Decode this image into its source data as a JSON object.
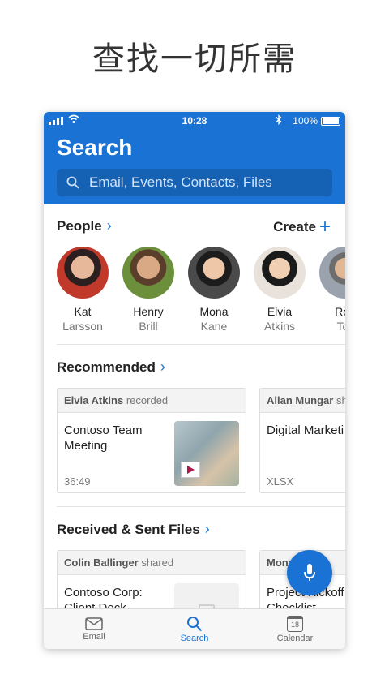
{
  "headline": "查找一切所需",
  "status": {
    "time": "10:28",
    "battery": "100%"
  },
  "header": {
    "title": "Search",
    "search_placeholder": "Email, Events, Contacts, Files"
  },
  "people": {
    "heading": "People",
    "create_label": "Create",
    "contacts": [
      {
        "first": "Kat",
        "last": "Larsson",
        "color": "#c0392b"
      },
      {
        "first": "Henry",
        "last": "Brill",
        "color": "#6b8f3a"
      },
      {
        "first": "Mona",
        "last": "Kane",
        "color": "#4a4a4a"
      },
      {
        "first": "Elvia",
        "last": "Atkins",
        "color": "#8e6b4e"
      },
      {
        "first": "Rob",
        "last": "Toll",
        "color": "#9aa3ad"
      }
    ]
  },
  "recommended": {
    "heading": "Recommended",
    "cards": [
      {
        "actor": "Elvia Atkins",
        "action": "recorded",
        "title": "Contoso Team Meeting",
        "meta": "36:49"
      },
      {
        "actor": "Allan Mungar",
        "action": "sh",
        "title": "Digital Marketi Plan",
        "meta": "XLSX"
      }
    ]
  },
  "files": {
    "heading": "Received & Sent Files",
    "cards": [
      {
        "actor": "Colin Ballinger",
        "action": "shared",
        "title": "Contoso Corp: Client Deck",
        "meta": ""
      },
      {
        "actor": "Mona",
        "action": "ma",
        "title": "Project Kickoff Checklist",
        "meta": ""
      }
    ]
  },
  "tabs": [
    {
      "label": "Email",
      "icon": "mail-icon"
    },
    {
      "label": "Search",
      "icon": "search-icon"
    },
    {
      "label": "Calendar",
      "icon": "calendar-icon",
      "day": "18"
    }
  ],
  "colors": {
    "accent": "#1a73d4"
  }
}
